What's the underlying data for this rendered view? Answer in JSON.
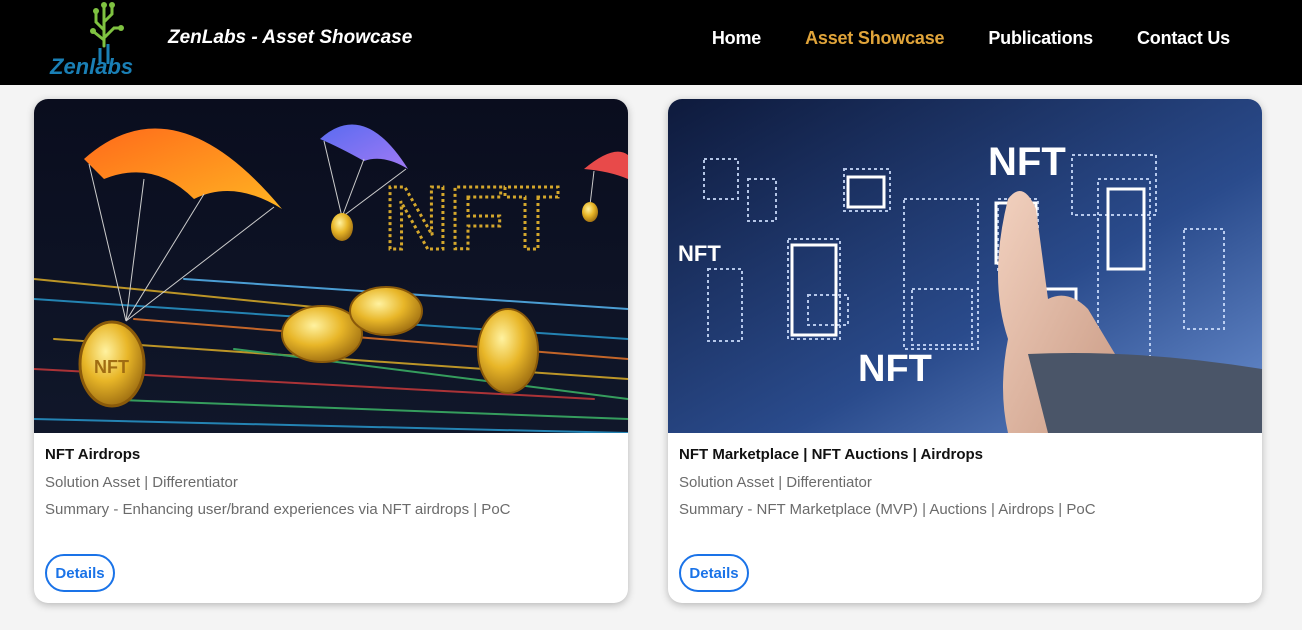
{
  "header": {
    "logo_text": "Zenlabs",
    "title": "ZenLabs - Asset Showcase",
    "nav": [
      {
        "label": "Home",
        "active": false
      },
      {
        "label": "Asset Showcase",
        "active": true
      },
      {
        "label": "Publications",
        "active": false
      },
      {
        "label": "Contact Us",
        "active": false
      }
    ],
    "active_color": "#e0a43a"
  },
  "cards": [
    {
      "title": "NFT Airdrops",
      "subtitle": "Solution Asset | Differentiator",
      "summary": "Summary - Enhancing user/brand experiences via NFT airdrops | PoC",
      "button": "Details",
      "image_text": "NFT",
      "coin_text": "NFT"
    },
    {
      "title": "NFT Marketplace | NFT Auctions | Airdrops",
      "subtitle": "Solution Asset | Differentiator",
      "summary": "Summary - NFT Marketplace (MVP) | Auctions | Airdrops | PoC",
      "button": "Details",
      "image_text_top": "NFT",
      "image_text_bottom": "NFT",
      "image_text_left": "NFT"
    }
  ],
  "colors": {
    "button_blue": "#1a73e8",
    "nav_bg": "#000000"
  }
}
